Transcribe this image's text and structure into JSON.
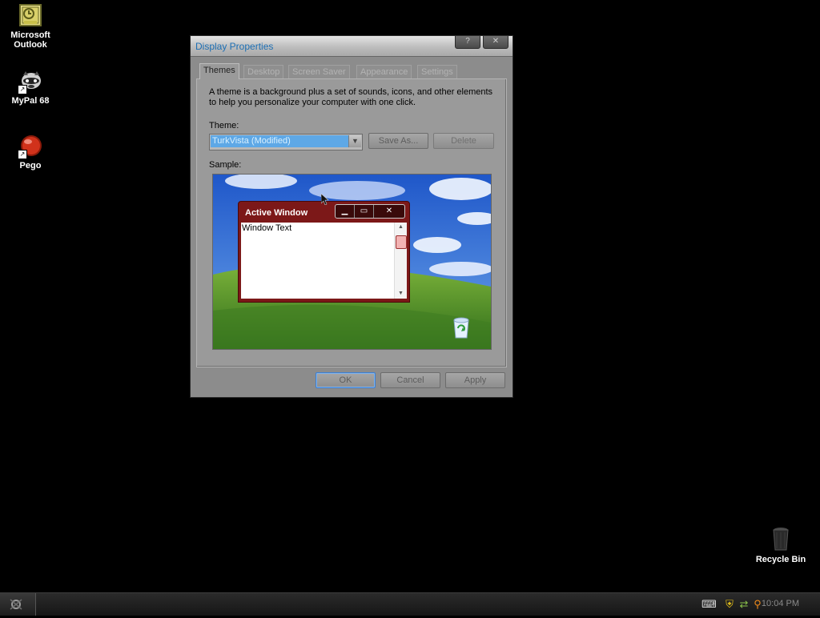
{
  "desktop": {
    "icons": [
      {
        "label": "Microsoft Outlook",
        "icon": "outlook-icon"
      },
      {
        "label": "MyPal 68",
        "icon": "mypal-raccoon-icon"
      },
      {
        "label": "Pego",
        "icon": "pego-red-ball-icon"
      }
    ],
    "recycle_bin": {
      "label": "Recycle Bin",
      "icon": "recycle-bin-icon"
    }
  },
  "window": {
    "title": "Display Properties",
    "help_button": "?",
    "close_button": "✕",
    "tabs": [
      {
        "label": "Themes",
        "active": true
      },
      {
        "label": "Desktop",
        "active": false
      },
      {
        "label": "Screen Saver",
        "active": false
      },
      {
        "label": "Appearance",
        "active": false
      },
      {
        "label": "Settings",
        "active": false
      }
    ],
    "description": "A theme is a background plus a set of sounds, icons, and other elements to help you personalize your computer with one click.",
    "theme_label": "Theme:",
    "theme_value": "TurkVista (Modified)",
    "save_as_label": "Save As...",
    "delete_label": "Delete",
    "sample_label": "Sample:",
    "sample": {
      "active_window_title": "Active Window",
      "window_text": "Window Text"
    },
    "ok_label": "OK",
    "cancel_label": "Cancel",
    "apply_label": "Apply"
  },
  "taskbar": {
    "clock": "10:04 PM",
    "tray_icons": [
      "keyboard-icon",
      "security-shield-icon",
      "network-icon",
      "search-magnifier-icon"
    ]
  },
  "colors": {
    "desktop_background": "#000000",
    "title_text": "#1d6fb4",
    "selection": "#5ea8e6",
    "sample_window_frame": "#7c1818"
  }
}
